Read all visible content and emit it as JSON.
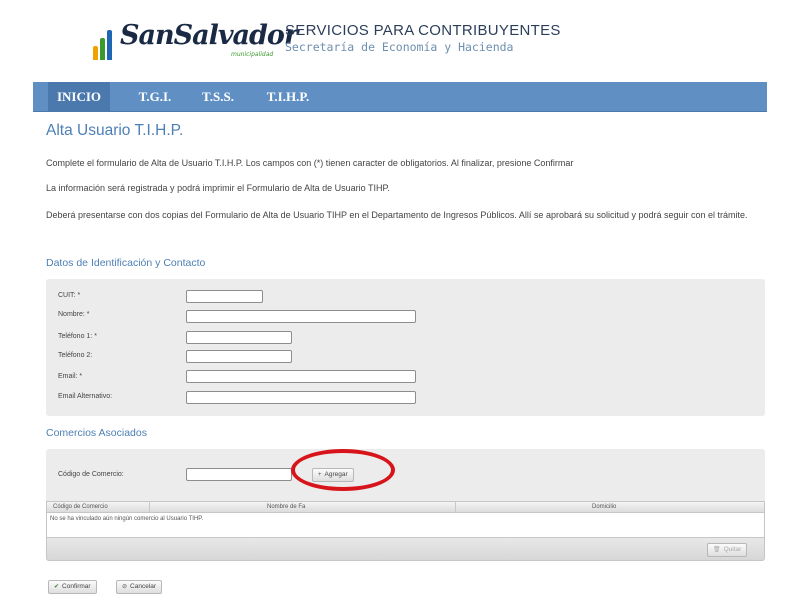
{
  "header": {
    "logo_text": "SanSalvador",
    "logo_sub": "municipalidad",
    "title": "SERVICIOS PARA CONTRIBUYENTES",
    "subtitle": "Secretaría de Economía y Hacienda"
  },
  "nav": {
    "items": [
      {
        "label": "INICIO",
        "active": true
      },
      {
        "label": "T.G.I."
      },
      {
        "label": "T.S.S."
      },
      {
        "label": "T.I.H.P."
      }
    ]
  },
  "page": {
    "title": "Alta Usuario T.I.H.P.",
    "para1": "Complete el formulario de Alta de Usuario T.I.H.P. Los campos con (*) tienen caracter de obligatorios. Al finalizar, presione Confirmar",
    "para2": "La información será registrada y podrá imprimir el Formulario de Alta de Usuario TIHP.",
    "para3": "Deberá presentarse con dos copias del Formulario de Alta de Usuario TIHP en el Departamento de Ingresos Públicos. Allí se aprobará su solicitud y podrá seguir con el trámite."
  },
  "section_id": {
    "title": "Datos de Identificación y Contacto",
    "fields": [
      {
        "label": "CUIT: *",
        "value": ""
      },
      {
        "label": "Nombre: *",
        "value": ""
      },
      {
        "label": "Teléfono 1: *",
        "value": ""
      },
      {
        "label": "Teléfono 2:",
        "value": ""
      },
      {
        "label": "Email: *",
        "value": ""
      },
      {
        "label": "Email Alternativo:",
        "value": ""
      }
    ]
  },
  "section_comercios": {
    "title": "Comercios Asociados",
    "codigo_label": "Código de Comercio:",
    "codigo_value": "",
    "agregar_label": "Agregar",
    "columns": [
      "Código de Comercio",
      "Nombre de Fa",
      "Domicilio"
    ],
    "empty_message": "No se ha vinculado aún ningún comercio al Usuario TIHP.",
    "quitar_label": "Quitar"
  },
  "actions": {
    "confirm_label": "Confirmar",
    "cancel_label": "Cancelar"
  },
  "colors": {
    "nav": "#5f8fc3",
    "accent": "#4d7fb5",
    "highlight_circle": "#d8141b"
  }
}
